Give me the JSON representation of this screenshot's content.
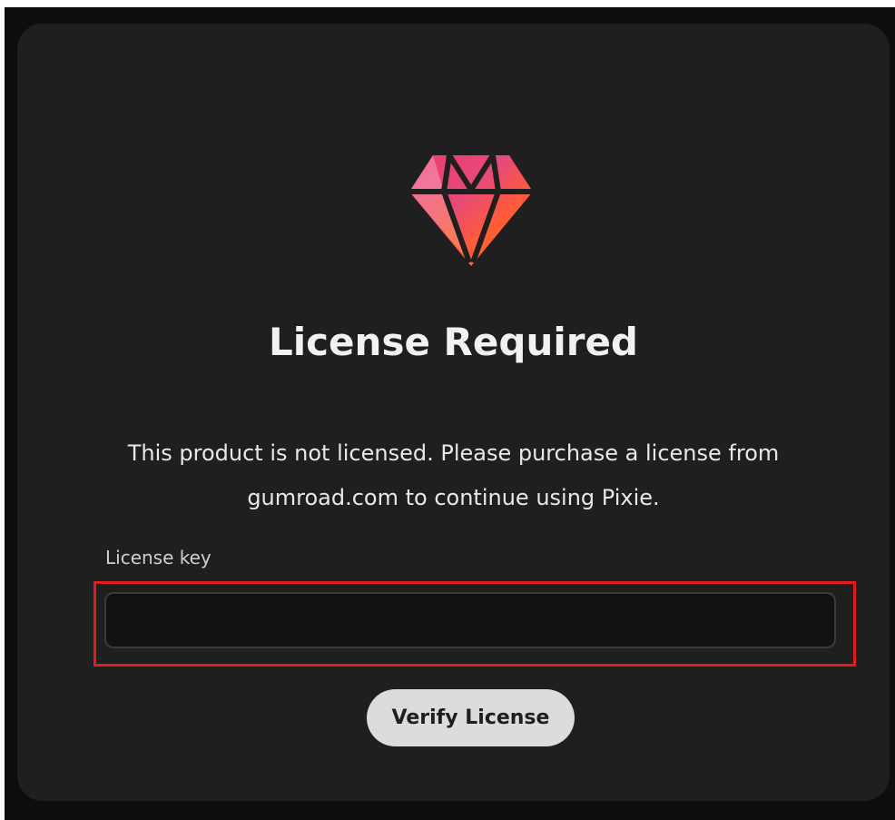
{
  "dialog": {
    "logo_icon": "gem-icon",
    "title": "License Required",
    "message_line1": "This product is not licensed. Please purchase a license from",
    "message_line2": "gumroad.com to continue using Pixie.",
    "key_label": "License key",
    "key_value": "",
    "verify_label": "Verify License"
  },
  "colors": {
    "background": "#1f1f1f",
    "highlight": "#e11c1c",
    "button": "#dcdcdc",
    "gem_gradient": [
      "#e85a8a",
      "#ff7a1a"
    ]
  }
}
